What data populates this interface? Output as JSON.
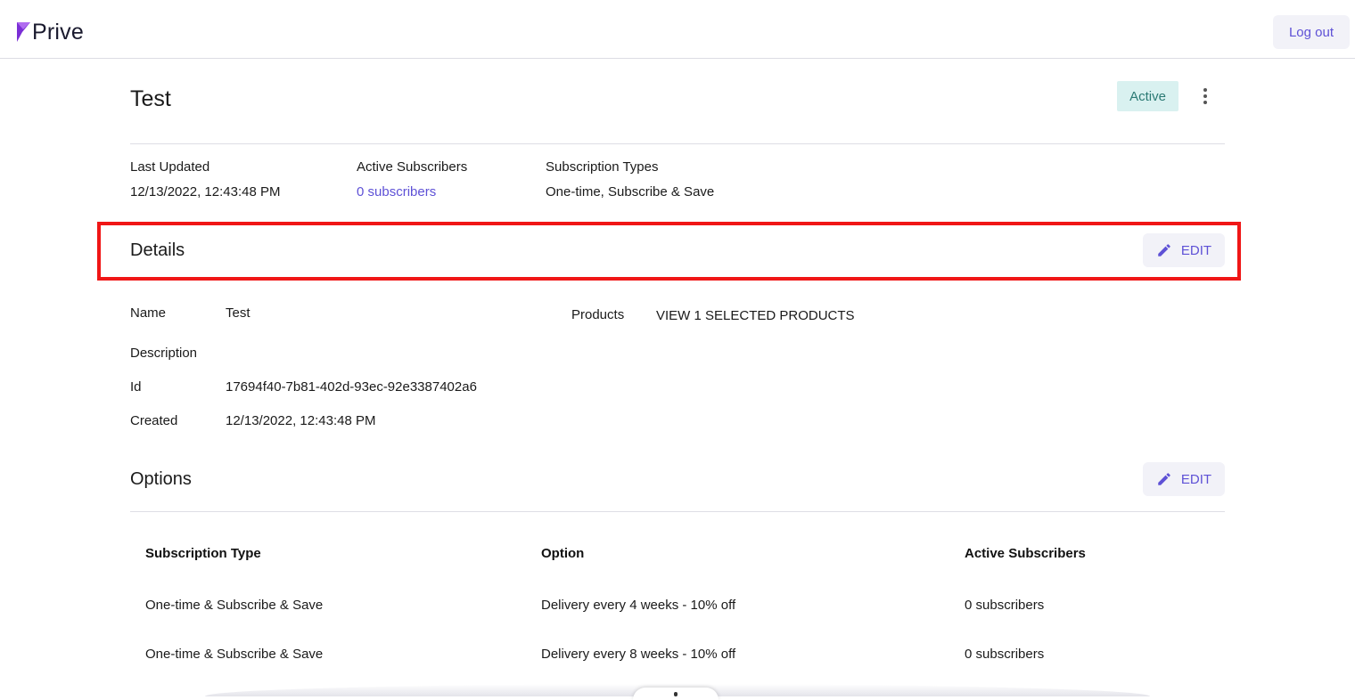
{
  "header": {
    "logo_text": "Prive",
    "logout_label": "Log out"
  },
  "page": {
    "title": "Test",
    "status": "Active"
  },
  "meta": {
    "last_updated_label": "Last Updated",
    "last_updated_value": "12/13/2022, 12:43:48 PM",
    "active_subscribers_label": "Active Subscribers",
    "active_subscribers_value": "0 subscribers",
    "subscription_types_label": "Subscription Types",
    "subscription_types_value": "One-time, Subscribe & Save"
  },
  "details": {
    "title": "Details",
    "edit_label": "EDIT",
    "name_label": "Name",
    "name_value": "Test",
    "description_label": "Description",
    "description_value": "",
    "id_label": "Id",
    "id_value": "17694f40-7b81-402d-93ec-92e3387402a6",
    "created_label": "Created",
    "created_value": "12/13/2022, 12:43:48 PM",
    "products_label": "Products",
    "products_link": "VIEW 1 SELECTED PRODUCTS"
  },
  "options": {
    "title": "Options",
    "edit_label": "EDIT",
    "columns": [
      "Subscription Type",
      "Option",
      "Active Subscribers"
    ],
    "rows": [
      {
        "type": "One-time & Subscribe & Save",
        "option": "Delivery every 4 weeks - 10% off",
        "subscribers": "0 subscribers"
      },
      {
        "type": "One-time & Subscribe & Save",
        "option": "Delivery every 8 weeks - 10% off",
        "subscribers": "0 subscribers"
      }
    ]
  },
  "colors": {
    "accent": "#5e51d6",
    "status_bg": "#d9f1f0",
    "status_text": "#2b7a74",
    "logo_mark": "#7b2fd6",
    "highlight": "#f01616"
  },
  "icons": {
    "logo": "prive-logo-icon",
    "edit": "pencil-icon",
    "menu": "more-vertical-icon"
  }
}
